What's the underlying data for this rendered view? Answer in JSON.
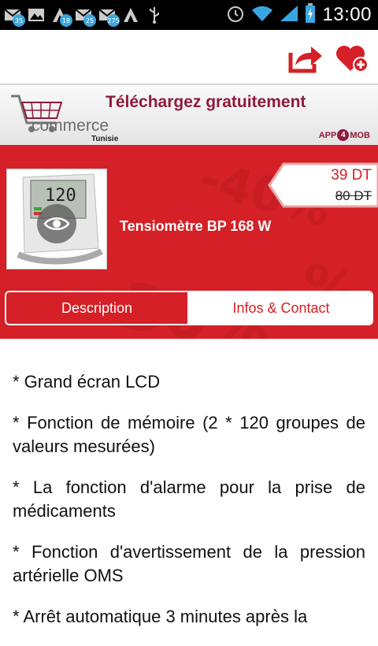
{
  "status_bar": {
    "time": "13:00",
    "notifications": [
      {
        "icon": "gmail-icon",
        "badge": "35"
      },
      {
        "icon": "image-icon",
        "badge": ""
      },
      {
        "icon": "a-icon",
        "badge": "18"
      },
      {
        "icon": "gmail-icon",
        "badge": "25"
      },
      {
        "icon": "gmail-icon",
        "badge": "275"
      },
      {
        "icon": "a-icon",
        "badge": ""
      },
      {
        "icon": "usb-icon",
        "badge": ""
      }
    ]
  },
  "action_bar": {
    "share_icon": "share-icon",
    "favorite_icon": "heart-plus-icon"
  },
  "banner": {
    "title": "Téléchargez gratuitement",
    "brand": "commerce",
    "subtitle": "Tunisie",
    "app_label_left": "APP",
    "app_label_mid": "4",
    "app_label_right": "MOB"
  },
  "product": {
    "name": "Tensiomètre BP 168 W",
    "price": "39 DT",
    "old_price": "80 DT",
    "device_reading": "120"
  },
  "tabs": [
    {
      "label": "Description",
      "active": true
    },
    {
      "label": "Infos & Contact",
      "active": false
    }
  ],
  "description": [
    "* Grand écran LCD",
    "* Fonction de mémoire (2 * 120 groupes de valeurs mesurées)",
    "* La fonction d'alarme pour la prise de médicaments",
    "* Fonction d'avertissement de la pression artérielle OMS",
    "* Arrêt automatique 3 minutes après la"
  ],
  "colors": {
    "accent": "#d42026",
    "banner_text": "#8f1b3a"
  }
}
